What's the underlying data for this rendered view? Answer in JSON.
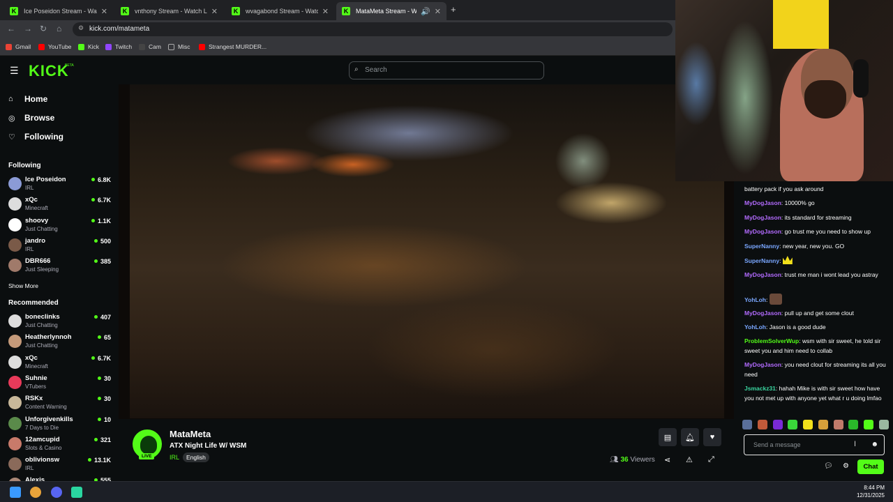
{
  "tabs": [
    {
      "title": "Ice Poseidon Stream - Watch Live on Kick",
      "active": false
    },
    {
      "title": "vnthony Stream - Watch Live on Kick",
      "active": false
    },
    {
      "title": "wvagabond Stream - Watch Live on Kick",
      "active": false
    },
    {
      "title": "MataMeta Stream - Watch Live on Kick",
      "active": true
    }
  ],
  "new_tab": "+",
  "url": "kick.com/matameta",
  "bookmarks": [
    {
      "label": "Gmail",
      "color": "#ea4335"
    },
    {
      "label": "YouTube",
      "color": "#ff0000"
    },
    {
      "label": "Kick",
      "color": "#53fc18"
    },
    {
      "label": "Twitch",
      "color": "#9146ff"
    },
    {
      "label": "Cam",
      "color": "#444444"
    },
    {
      "label": "Misc",
      "color": "#888888"
    },
    {
      "label": "Strangest MURDER...",
      "color": "#ff0000"
    }
  ],
  "header": {
    "logo": "KICK",
    "logo_badge": "BETA",
    "search_placeholder": "Search"
  },
  "nav": [
    {
      "label": "Home",
      "icon": "home-icon"
    },
    {
      "label": "Browse",
      "icon": "compass-icon"
    },
    {
      "label": "Following",
      "icon": "heart-icon"
    }
  ],
  "following": {
    "heading": "Following",
    "channels": [
      {
        "name": "Ice Poseidon",
        "category": "IRL",
        "viewers": "6.8K",
        "color": "#8b9bd6"
      },
      {
        "name": "xQc",
        "category": "Minecraft",
        "viewers": "6.7K",
        "color": "#dddddd"
      },
      {
        "name": "shoovy",
        "category": "Just Chatting",
        "viewers": "1.1K",
        "color": "#ffffff"
      },
      {
        "name": "jandro",
        "category": "IRL",
        "viewers": "500",
        "color": "#7a5a48"
      },
      {
        "name": "DBR666",
        "category": "Just Sleeping",
        "viewers": "385",
        "color": "#a07a6a"
      }
    ],
    "show_more": "Show More"
  },
  "recommended": {
    "heading": "Recommended",
    "channels": [
      {
        "name": "boneclinks",
        "category": "Just Chatting",
        "viewers": "407",
        "color": "#dddddd"
      },
      {
        "name": "Heatherlynnoh",
        "category": "Just Chatting",
        "viewers": "65",
        "color": "#c49a7a"
      },
      {
        "name": "xQc",
        "category": "Minecraft",
        "viewers": "6.7K",
        "color": "#dddddd"
      },
      {
        "name": "Suhnie",
        "category": "VTubers",
        "viewers": "30",
        "color": "#e83a5a"
      },
      {
        "name": "RSKx",
        "category": "Content Warning",
        "viewers": "30",
        "color": "#c8b89a"
      },
      {
        "name": "Unforgivenkills",
        "category": "7 Days to Die",
        "viewers": "10",
        "color": "#5a8a4a"
      },
      {
        "name": "12amcupid",
        "category": "Slots & Casino",
        "viewers": "321",
        "color": "#c87a6a"
      },
      {
        "name": "oblivionsw",
        "category": "IRL",
        "viewers": "13.1K",
        "color": "#8a6a5a"
      },
      {
        "name": "Alexis",
        "category": "",
        "viewers": "555",
        "color": "#aa8877"
      }
    ]
  },
  "stream": {
    "name": "MataMeta",
    "title": "ATX Night Life W/ WSM",
    "category": "IRL",
    "language": "English",
    "live_badge": "LIVE",
    "viewers_count": "36",
    "viewers_label": "Viewers"
  },
  "chat": {
    "messages": [
      {
        "user": "",
        "text": "battery pack if you ask around",
        "color": "#ffffff"
      },
      {
        "user": "MyDogJason",
        "text": "10000% go",
        "color": "#b36bff"
      },
      {
        "user": "MyDogJason",
        "text": "its standard for streaming",
        "color": "#b36bff"
      },
      {
        "user": "MyDogJason",
        "text": "go trust me you need to show up",
        "color": "#b36bff"
      },
      {
        "user": "SuperNanny",
        "text": "new year, new you. GO",
        "color": "#7aa7ff"
      },
      {
        "user": "SuperNanny",
        "text": "",
        "color": "#7aa7ff",
        "emote": "crown-emote"
      },
      {
        "user": "MyDogJason",
        "text": "trust me man i wont lead you astray",
        "color": "#b36bff"
      },
      {
        "user": "YohLoh",
        "text": "",
        "color": "#7aa7ff",
        "emote": "face-emote"
      },
      {
        "user": "MyDogJason",
        "text": "pull up and get some clout",
        "color": "#b36bff"
      },
      {
        "user": "YohLoh",
        "text": "Jason is a good dude",
        "color": "#7aa7ff"
      },
      {
        "user": "ProblemSolverWup",
        "text": "wsm with sir sweet, he told sir sweet you and him need to collab",
        "color": "#53fc18"
      },
      {
        "user": "MyDogJason",
        "text": "you need clout for streaming its all you need",
        "color": "#b36bff"
      },
      {
        "user": "Jsmackz31",
        "text": "hahah Mike is with sir sweet how have you not met up with anyone yet what r u doing lmfao",
        "color": "#3ad6a0"
      }
    ],
    "input_placeholder": "Send a message",
    "send_label": "Chat",
    "separator": ": "
  },
  "taskbar": {
    "time": "8:44 PM",
    "date": "12/31/2025"
  },
  "colors": {
    "accent": "#53fc18",
    "bg": "#0b0e0f"
  }
}
